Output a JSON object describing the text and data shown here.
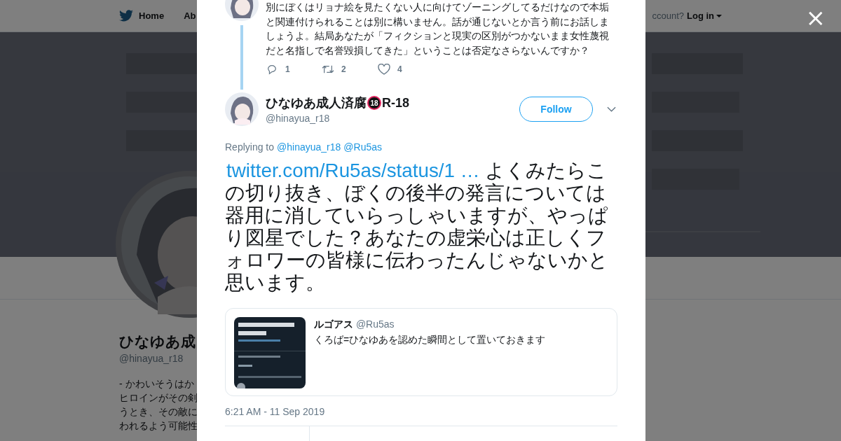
{
  "nav": {
    "items": [
      "Home",
      "Ab"
    ],
    "login_prompt": "ccount?",
    "login": "Log in"
  },
  "profile": {
    "name": "ひなゆあ成",
    "handle": "@hinayua_r18",
    "bio_lines": [
      "- かわいそうはか",
      "ヒロインがその剣",
      "うとき、その敵に",
      "われるよう可能性"
    ]
  },
  "previous_tweet": {
    "text": "別にぼくはリョナ絵を見たくない人に向けてゾーニングしてるだけなので本垢と関連付けられることは別に構いません。話が通じないとか言う前にお話しましょうよ。結局あなたが「フィクションと現実の区別がつかないまま女性蔑視だと名指しで名誉毀損してきた」ということは否定なさらないんですか？",
    "actions": [
      {
        "kind": "reply",
        "count": "1"
      },
      {
        "kind": "retweet",
        "count": "2"
      },
      {
        "kind": "like",
        "count": "4"
      }
    ]
  },
  "tweet": {
    "name": "ひなゆあ成人済腐",
    "badge": "18",
    "name_suffix": "R-18",
    "handle": "@hinayua_r18",
    "follow": "Follow",
    "replying_label": "Replying to",
    "replying_to": [
      "@hinayua_r18",
      "@Ru5as"
    ],
    "link": "twitter.com/Ru5as/status/1 …",
    "text": " よくみたらこの切り抜き、ぼくの後半の発言については器用に消していらっしゃいますが、やっぱり図星でした？あなたの虚栄心は正しくフォロワーの皆様に伝わったんじゃないかと思います。",
    "quote": {
      "name": "ルゴアス",
      "handle": "@Ru5as",
      "text": "くろば=ひなゆあを認めた瞬間として置いておきます"
    },
    "time": "6:21 AM - 11 Sep 2019"
  },
  "close": "×"
}
